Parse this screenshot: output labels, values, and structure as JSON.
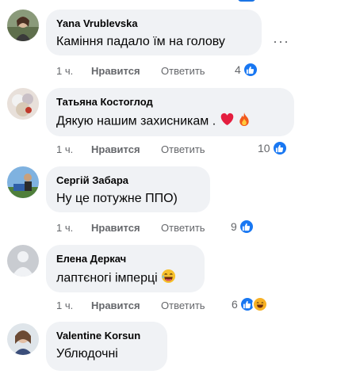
{
  "comments": [
    {
      "author": "Yana Vrublevska",
      "text": "Каміння падало їм на голову",
      "time": "1 ч.",
      "like": "Нравится",
      "reply": "Ответить",
      "reactions": "4"
    },
    {
      "author": "Татьяна Костоглод",
      "text": "Дякую нашим захисникам .",
      "time": "1 ч.",
      "like": "Нравится",
      "reply": "Ответить",
      "reactions": "10"
    },
    {
      "author": "Сергій Забара",
      "text": "Ну це потужне ППО)",
      "time": "1 ч.",
      "like": "Нравится",
      "reply": "Ответить",
      "reactions": "9"
    },
    {
      "author": "Елена Деркач",
      "text": "лаптєногі імперці",
      "time": "1 ч.",
      "like": "Нравится",
      "reply": "Ответить",
      "reactions": "6"
    },
    {
      "author": "Valentine Korsun",
      "text": "Ублюдочні"
    }
  ],
  "more_options": "···",
  "colors": {
    "accent": "#1877f2",
    "bubble": "#f0f2f5",
    "meta": "#65676b"
  },
  "icons": [
    "like-reaction-icon",
    "haha-reaction-icon",
    "heart-emoji-icon",
    "fire-emoji-icon",
    "laughing-emoji-icon",
    "more-options-icon"
  ]
}
